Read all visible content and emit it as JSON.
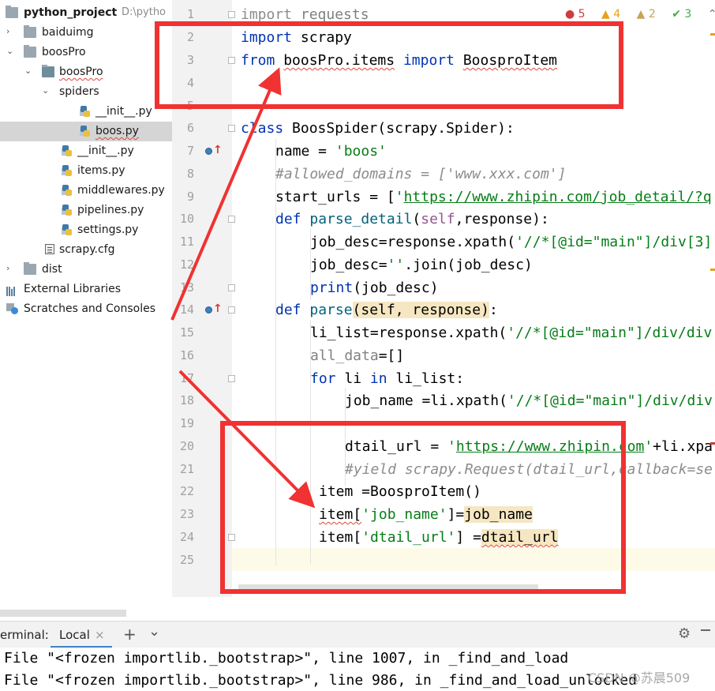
{
  "project_tree": {
    "root": {
      "name": "python_project",
      "path": "D:\\pytho"
    },
    "items": [
      {
        "label": "baiduimg"
      },
      {
        "label": "boosPro"
      },
      {
        "label": "boosPro"
      },
      {
        "label": "spiders"
      },
      {
        "label": "__init__.py"
      },
      {
        "label": "boos.py"
      },
      {
        "label": "__init__.py"
      },
      {
        "label": "items.py"
      },
      {
        "label": "middlewares.py"
      },
      {
        "label": "pipelines.py"
      },
      {
        "label": "settings.py"
      },
      {
        "label": "scrapy.cfg"
      },
      {
        "label": "dist"
      },
      {
        "label": "External Libraries"
      },
      {
        "label": "Scratches and Consoles"
      }
    ]
  },
  "inspections": {
    "errors": "5",
    "warnings": "4",
    "weak_warnings": "2",
    "ok": "3"
  },
  "editor": {
    "line_numbers": [
      "1",
      "2",
      "3",
      "4",
      "5",
      "6",
      "7",
      "8",
      "9",
      "10",
      "11",
      "12",
      "13",
      "14",
      "15",
      "16",
      "17",
      "18",
      "19",
      "20",
      "21",
      "22",
      "23",
      "24",
      "25"
    ],
    "lines": {
      "l1_kw": "import",
      "l1_rest": " requests",
      "l2_kw": "import",
      "l2_rest": " scrapy",
      "l3_kw1": "from",
      "l3_mod": "boosPro.items",
      "l3_kw2": "import",
      "l3_cls": "BoosproItem",
      "l6_kw": "class",
      "l6_rest": " BoosSpider(scrapy.Spider):",
      "l7_a": "name = ",
      "l7_s": "'boos'",
      "l8_c": "#allowed_domains = ['www.xxx.com']",
      "l9_a": "start_urls = [",
      "l9_q": "'",
      "l9_u": "https://www.zhipin.com/job_detail/?q",
      "l10_kw": "def",
      "l10_fn": "parse_detail",
      "l10_a": "(",
      "l10_self": "self",
      "l10_b": ",response):",
      "l11_a": "job_desc=response.xpath(",
      "l11_s": "'//*[@id=\"main\"]/div[3]",
      "l12_a": "job_desc=",
      "l12_s": "''",
      "l12_b": ".join(job_desc)",
      "l13_fn": "print",
      "l13_a": "(job_desc)",
      "l14_kw": "def",
      "l14_fn": "parse",
      "l14_self": "(self, response)",
      "l14_b": ":",
      "l15_a": "li_list=response.xpath(",
      "l15_s": "'//*[@id=\"main\"]/div/div",
      "l16_a": "all_data",
      "l16_b": "=[]",
      "l17_kw1": "for",
      "l17_a": " li ",
      "l17_kw2": "in",
      "l17_b": " li_list:",
      "l18_a": "job_name =li.xpath(",
      "l18_s": "'//*[@id=\"main\"]/div/div",
      "l20_a": "dtail_url = ",
      "l20_q": "'",
      "l20_u": "https://www.zhipin.com",
      "l20_q2": "'",
      "l20_b": "+li.xpa",
      "l21_c": "#yield scrapy.Request(dtail_url,callback=se",
      "l22_a": "item =BoosproItem()",
      "l23_a": "item[",
      "l23_s": "'job_name'",
      "l23_b": "]=",
      "l23_c": "job_name",
      "l24_a": "item[",
      "l24_s": "'dtail_url'",
      "l24_b": "] =",
      "l24_c": "dtail_url"
    }
  },
  "tool_window": {
    "label": "erminal:",
    "tab": "Local",
    "close": "×",
    "add": "+",
    "chevron": "⌄",
    "gear": "⚙",
    "lines": [
      "File \"<frozen importlib._bootstrap>\", line 1007, in _find_and_load",
      "File \"<frozen importlib._bootstrap>\", line 986, in _find_and_load_unlocked"
    ]
  },
  "watermark": "CSDN @苏晨509",
  "colors": {
    "annotation_red": "#f03232",
    "keyword": "#0033b3",
    "string": "#067d17"
  }
}
